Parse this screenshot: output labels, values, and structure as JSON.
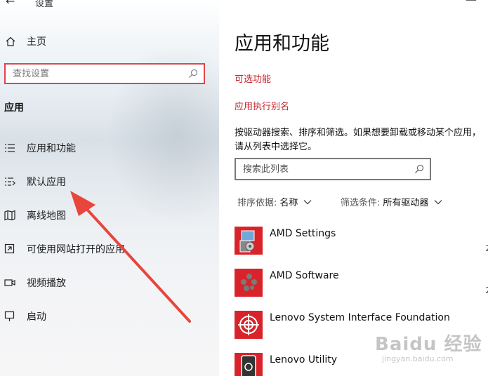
{
  "window": {
    "title": "设置"
  },
  "sidebar": {
    "home_label": "主页",
    "search_placeholder": "查找设置",
    "section_title": "应用",
    "items": [
      {
        "label": "应用和功能",
        "icon": "apps-list-icon"
      },
      {
        "label": "默认应用",
        "icon": "default-apps-icon"
      },
      {
        "label": "离线地图",
        "icon": "offline-map-icon"
      },
      {
        "label": "可使用网站打开的应用",
        "icon": "website-app-icon"
      },
      {
        "label": "视频播放",
        "icon": "video-icon"
      },
      {
        "label": "启动",
        "icon": "startup-icon"
      }
    ]
  },
  "main": {
    "title": "应用和功能",
    "optional_features_link": "可选功能",
    "alias_link": "应用执行别名",
    "description": "按驱动器搜索、排序和筛选。如果想要卸载或移动某个应用，请从列表中选择它。",
    "search_placeholder": "搜索此列表",
    "sort_label": "排序依据:",
    "sort_value": "名称",
    "filter_label": "筛选条件:",
    "filter_value": "所有驱动器",
    "apps": [
      {
        "name": "AMD Settings",
        "date_fragment": "2"
      },
      {
        "name": "AMD Software",
        "date_fragment": "2"
      },
      {
        "name": "Lenovo System Interface Foundation",
        "date_fragment": ""
      },
      {
        "name": "Lenovo Utility",
        "date_fragment": ""
      }
    ]
  },
  "watermark": {
    "main": "Baidu 经验",
    "sub": "jingyan.baidu.com"
  },
  "colors": {
    "accent_red": "#c4262e",
    "search_border_red": "#e0454d",
    "app_tile_red": "#d9232a",
    "arrow_red": "#e8453c"
  }
}
